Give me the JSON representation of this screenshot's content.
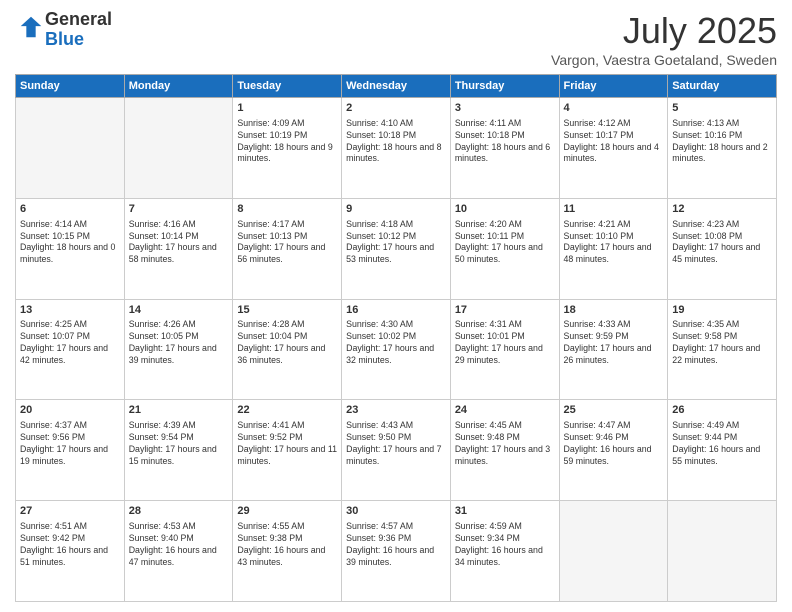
{
  "logo": {
    "general": "General",
    "blue": "Blue"
  },
  "header": {
    "month": "July 2025",
    "location": "Vargon, Vaestra Goetaland, Sweden"
  },
  "weekdays": [
    "Sunday",
    "Monday",
    "Tuesday",
    "Wednesday",
    "Thursday",
    "Friday",
    "Saturday"
  ],
  "weeks": [
    [
      {
        "day": "",
        "empty": true
      },
      {
        "day": "",
        "empty": true
      },
      {
        "day": "1",
        "sunrise": "4:09 AM",
        "sunset": "10:19 PM",
        "daylight": "18 hours and 9 minutes."
      },
      {
        "day": "2",
        "sunrise": "4:10 AM",
        "sunset": "10:18 PM",
        "daylight": "18 hours and 8 minutes."
      },
      {
        "day": "3",
        "sunrise": "4:11 AM",
        "sunset": "10:18 PM",
        "daylight": "18 hours and 6 minutes."
      },
      {
        "day": "4",
        "sunrise": "4:12 AM",
        "sunset": "10:17 PM",
        "daylight": "18 hours and 4 minutes."
      },
      {
        "day": "5",
        "sunrise": "4:13 AM",
        "sunset": "10:16 PM",
        "daylight": "18 hours and 2 minutes."
      }
    ],
    [
      {
        "day": "6",
        "sunrise": "4:14 AM",
        "sunset": "10:15 PM",
        "daylight": "18 hours and 0 minutes."
      },
      {
        "day": "7",
        "sunrise": "4:16 AM",
        "sunset": "10:14 PM",
        "daylight": "17 hours and 58 minutes."
      },
      {
        "day": "8",
        "sunrise": "4:17 AM",
        "sunset": "10:13 PM",
        "daylight": "17 hours and 56 minutes."
      },
      {
        "day": "9",
        "sunrise": "4:18 AM",
        "sunset": "10:12 PM",
        "daylight": "17 hours and 53 minutes."
      },
      {
        "day": "10",
        "sunrise": "4:20 AM",
        "sunset": "10:11 PM",
        "daylight": "17 hours and 50 minutes."
      },
      {
        "day": "11",
        "sunrise": "4:21 AM",
        "sunset": "10:10 PM",
        "daylight": "17 hours and 48 minutes."
      },
      {
        "day": "12",
        "sunrise": "4:23 AM",
        "sunset": "10:08 PM",
        "daylight": "17 hours and 45 minutes."
      }
    ],
    [
      {
        "day": "13",
        "sunrise": "4:25 AM",
        "sunset": "10:07 PM",
        "daylight": "17 hours and 42 minutes."
      },
      {
        "day": "14",
        "sunrise": "4:26 AM",
        "sunset": "10:05 PM",
        "daylight": "17 hours and 39 minutes."
      },
      {
        "day": "15",
        "sunrise": "4:28 AM",
        "sunset": "10:04 PM",
        "daylight": "17 hours and 36 minutes."
      },
      {
        "day": "16",
        "sunrise": "4:30 AM",
        "sunset": "10:02 PM",
        "daylight": "17 hours and 32 minutes."
      },
      {
        "day": "17",
        "sunrise": "4:31 AM",
        "sunset": "10:01 PM",
        "daylight": "17 hours and 29 minutes."
      },
      {
        "day": "18",
        "sunrise": "4:33 AM",
        "sunset": "9:59 PM",
        "daylight": "17 hours and 26 minutes."
      },
      {
        "day": "19",
        "sunrise": "4:35 AM",
        "sunset": "9:58 PM",
        "daylight": "17 hours and 22 minutes."
      }
    ],
    [
      {
        "day": "20",
        "sunrise": "4:37 AM",
        "sunset": "9:56 PM",
        "daylight": "17 hours and 19 minutes."
      },
      {
        "day": "21",
        "sunrise": "4:39 AM",
        "sunset": "9:54 PM",
        "daylight": "17 hours and 15 minutes."
      },
      {
        "day": "22",
        "sunrise": "4:41 AM",
        "sunset": "9:52 PM",
        "daylight": "17 hours and 11 minutes."
      },
      {
        "day": "23",
        "sunrise": "4:43 AM",
        "sunset": "9:50 PM",
        "daylight": "17 hours and 7 minutes."
      },
      {
        "day": "24",
        "sunrise": "4:45 AM",
        "sunset": "9:48 PM",
        "daylight": "17 hours and 3 minutes."
      },
      {
        "day": "25",
        "sunrise": "4:47 AM",
        "sunset": "9:46 PM",
        "daylight": "16 hours and 59 minutes."
      },
      {
        "day": "26",
        "sunrise": "4:49 AM",
        "sunset": "9:44 PM",
        "daylight": "16 hours and 55 minutes."
      }
    ],
    [
      {
        "day": "27",
        "sunrise": "4:51 AM",
        "sunset": "9:42 PM",
        "daylight": "16 hours and 51 minutes."
      },
      {
        "day": "28",
        "sunrise": "4:53 AM",
        "sunset": "9:40 PM",
        "daylight": "16 hours and 47 minutes."
      },
      {
        "day": "29",
        "sunrise": "4:55 AM",
        "sunset": "9:38 PM",
        "daylight": "16 hours and 43 minutes."
      },
      {
        "day": "30",
        "sunrise": "4:57 AM",
        "sunset": "9:36 PM",
        "daylight": "16 hours and 39 minutes."
      },
      {
        "day": "31",
        "sunrise": "4:59 AM",
        "sunset": "9:34 PM",
        "daylight": "16 hours and 34 minutes."
      },
      {
        "day": "",
        "empty": true
      },
      {
        "day": "",
        "empty": true
      }
    ]
  ]
}
